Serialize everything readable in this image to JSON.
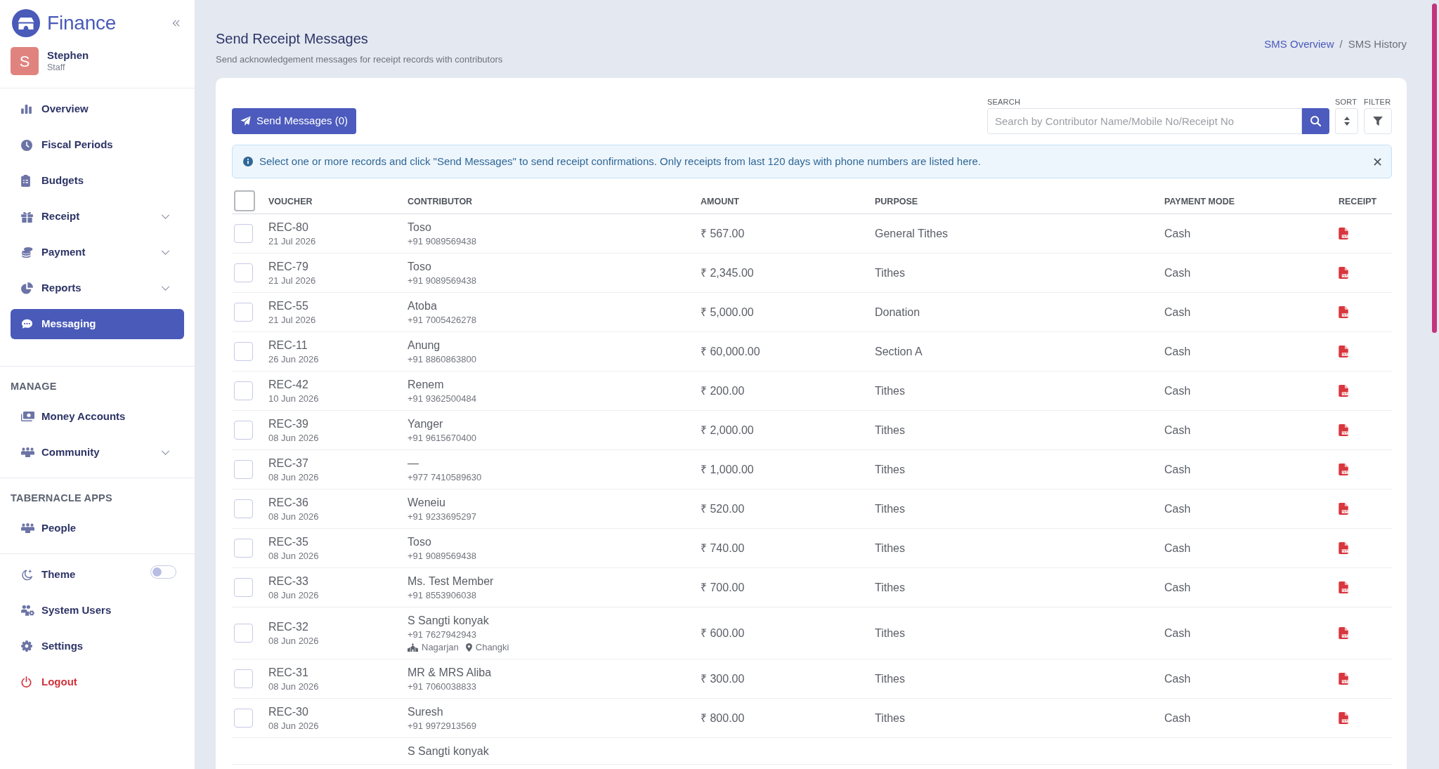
{
  "sidebar": {
    "brand": "Finance",
    "user": {
      "initial": "S",
      "name": "Stephen",
      "role": "Staff"
    },
    "sections": [
      {
        "items": [
          {
            "kind": "link",
            "label": "Overview",
            "selected": false
          },
          {
            "kind": "link",
            "label": "Fiscal Periods",
            "selected": false
          },
          {
            "kind": "link",
            "label": "Budgets",
            "selected": false
          },
          {
            "kind": "group",
            "label": "Receipt",
            "selected": false,
            "expanded": false
          },
          {
            "kind": "group",
            "label": "Payment",
            "selected": false,
            "expanded": false
          },
          {
            "kind": "group",
            "label": "Reports",
            "selected": false,
            "expanded": false
          },
          {
            "kind": "link",
            "label": "Messaging",
            "selected": true
          }
        ]
      },
      {
        "title": "MANAGE",
        "items": [
          {
            "kind": "link",
            "label": "Money Accounts",
            "selected": false
          },
          {
            "kind": "group",
            "label": "Community",
            "selected": false,
            "expanded": false
          }
        ]
      },
      {
        "title": "TABERNACLE APPS",
        "items": [
          {
            "kind": "link",
            "label": "People",
            "selected": false
          }
        ]
      },
      {
        "items": [
          {
            "kind": "toggle",
            "label": "Theme",
            "on": false
          },
          {
            "kind": "link",
            "label": "System Users",
            "selected": false
          },
          {
            "kind": "link",
            "label": "Settings",
            "selected": false
          },
          {
            "kind": "logout",
            "label": "Logout",
            "selected": false
          }
        ]
      }
    ]
  },
  "header": {
    "title": "Send Receipt Messages",
    "subtitle": "Send acknowledgement messages for receipt records with contributors",
    "breadcrumb": [
      {
        "kind": "link",
        "label": "SMS Overview"
      },
      {
        "kind": "separator",
        "label": "/"
      },
      {
        "kind": "current",
        "label": "SMS History"
      }
    ]
  },
  "toolbar": {
    "send_button": "Send Messages (0)",
    "search": {
      "label": "SEARCH",
      "placeholder": "Search by Contributor Name/Mobile No/Receipt No"
    },
    "sort": {
      "label": "SORT"
    },
    "filter": {
      "label": "FILTER"
    }
  },
  "alert": {
    "text": "Select one or more records and click \"Send Messages\" to send receipt confirmations. Only receipts from last 120 days with phone numbers are listed here."
  },
  "table": {
    "select_all": {
      "checked": false
    },
    "columns": [
      "VOUCHER",
      "CONTRIBUTOR",
      "AMOUNT",
      "PURPOSE",
      "PAYMENT MODE",
      "RECEIPT"
    ],
    "rows": [
      {
        "checked": false,
        "voucher": "REC-80",
        "date": "21 Jul 2026",
        "name": "Toso",
        "phone": "+91 9089569438",
        "amount": "₹ 567.00",
        "purpose": "General Tithes",
        "mode": "Cash"
      },
      {
        "checked": false,
        "voucher": "REC-79",
        "date": "21 Jul 2026",
        "name": "Toso",
        "phone": "+91 9089569438",
        "amount": "₹ 2,345.00",
        "purpose": "Tithes",
        "mode": "Cash"
      },
      {
        "checked": false,
        "voucher": "REC-55",
        "date": "21 Jul 2026",
        "name": "Atoba",
        "phone": "+91 7005426278",
        "amount": "₹ 5,000.00",
        "purpose": "Donation",
        "mode": "Cash"
      },
      {
        "checked": false,
        "voucher": "REC-11",
        "date": "26 Jun 2026",
        "name": "Anung",
        "phone": "+91 8860863800",
        "amount": "₹ 60,000.00",
        "purpose": "Section A",
        "mode": "Cash"
      },
      {
        "checked": false,
        "voucher": "REC-42",
        "date": "10 Jun 2026",
        "name": "Renem",
        "phone": "+91 9362500484",
        "amount": "₹ 200.00",
        "purpose": "Tithes",
        "mode": "Cash"
      },
      {
        "checked": false,
        "voucher": "REC-39",
        "date": "08 Jun 2026",
        "name": "Yanger",
        "phone": "+91 9615670400",
        "amount": "₹ 2,000.00",
        "purpose": "Tithes",
        "mode": "Cash"
      },
      {
        "checked": false,
        "voucher": "REC-37",
        "date": "08 Jun 2026",
        "name": "—",
        "phone": "+977 7410589630",
        "amount": "₹ 1,000.00",
        "purpose": "Tithes",
        "mode": "Cash"
      },
      {
        "checked": false,
        "voucher": "REC-36",
        "date": "08 Jun 2026",
        "name": "Weneiu",
        "phone": "+91 9233695297",
        "amount": "₹ 520.00",
        "purpose": "Tithes",
        "mode": "Cash"
      },
      {
        "checked": false,
        "voucher": "REC-35",
        "date": "08 Jun 2026",
        "name": "Toso",
        "phone": "+91 9089569438",
        "amount": "₹ 740.00",
        "purpose": "Tithes",
        "mode": "Cash"
      },
      {
        "checked": false,
        "voucher": "REC-33",
        "date": "08 Jun 2026",
        "name": "Ms. Test Member",
        "phone": "+91 8553906038",
        "amount": "₹ 700.00",
        "purpose": "Tithes",
        "mode": "Cash"
      },
      {
        "checked": false,
        "voucher": "REC-32",
        "date": "08 Jun 2026",
        "name": "S Sangti konyak",
        "phone": "+91 7627942943",
        "community": "Nagarjan",
        "place": "Changki",
        "amount": "₹ 600.00",
        "purpose": "Tithes",
        "mode": "Cash"
      },
      {
        "checked": false,
        "voucher": "REC-31",
        "date": "08 Jun 2026",
        "name": "MR & MRS Aliba",
        "phone": "+91 7060038833",
        "amount": "₹ 300.00",
        "purpose": "Tithes",
        "mode": "Cash"
      },
      {
        "checked": false,
        "voucher": "REC-30",
        "date": "08 Jun 2026",
        "name": "Suresh",
        "phone": "+91 9972913569",
        "amount": "₹ 800.00",
        "purpose": "Tithes",
        "mode": "Cash"
      },
      {
        "name": "S Sangti konyak"
      }
    ]
  }
}
